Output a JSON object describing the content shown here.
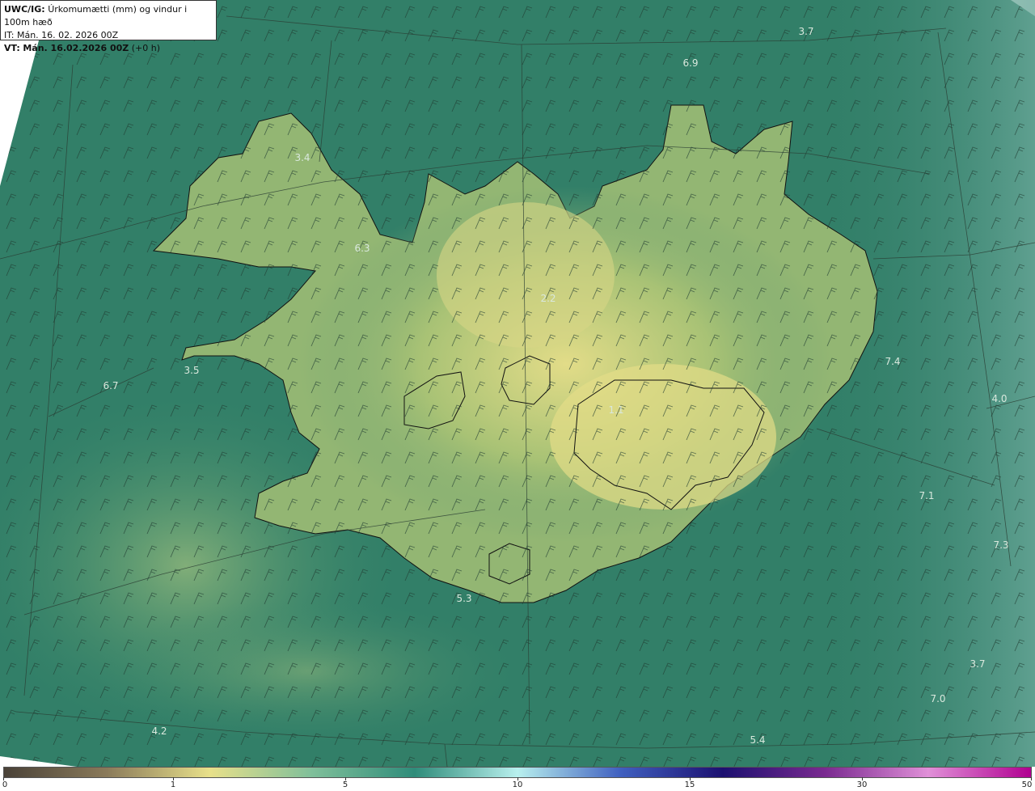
{
  "info": {
    "product": "UWC/IG:",
    "title": "Úrkomumætti (mm) og vindur i 100m hæð",
    "it_label": "IT:",
    "it_value": "Mán. 16. 02. 2026 00Z",
    "vt_label": "VT:",
    "vt_value": "Mán. 16.02.2026 00Z",
    "vt_offset": "(+0 h)"
  },
  "value_labels": [
    {
      "text": "3.7"
    },
    {
      "text": "6.9"
    },
    {
      "text": "3.4"
    },
    {
      "text": "6.3"
    },
    {
      "text": "2.2"
    },
    {
      "text": "3.5"
    },
    {
      "text": "6.7"
    },
    {
      "text": "7.4"
    },
    {
      "text": "4.0"
    },
    {
      "text": "1.1"
    },
    {
      "text": "7.1"
    },
    {
      "text": "7.3"
    },
    {
      "text": "5.3"
    },
    {
      "text": "3.7"
    },
    {
      "text": "7.0"
    },
    {
      "text": "4.2"
    },
    {
      "text": "5.4"
    }
  ],
  "colorbar": {
    "ticks": [
      "0",
      "1",
      "5",
      "10",
      "15",
      "30",
      "50"
    ],
    "colors": [
      "#4a4238",
      "#8a7a5a",
      "#e8e08a",
      "#7fbf9a",
      "#2f8c7a",
      "#b8f0ee",
      "#4060c0",
      "#1c1070",
      "#7a2a90",
      "#e090d8",
      "#b00090"
    ]
  },
  "legend_colors": {
    "sea": "#2f7d66",
    "land": "#b9c878",
    "highland": "#e6e08c",
    "coast": "#111111",
    "grid": "#3a4a40"
  }
}
